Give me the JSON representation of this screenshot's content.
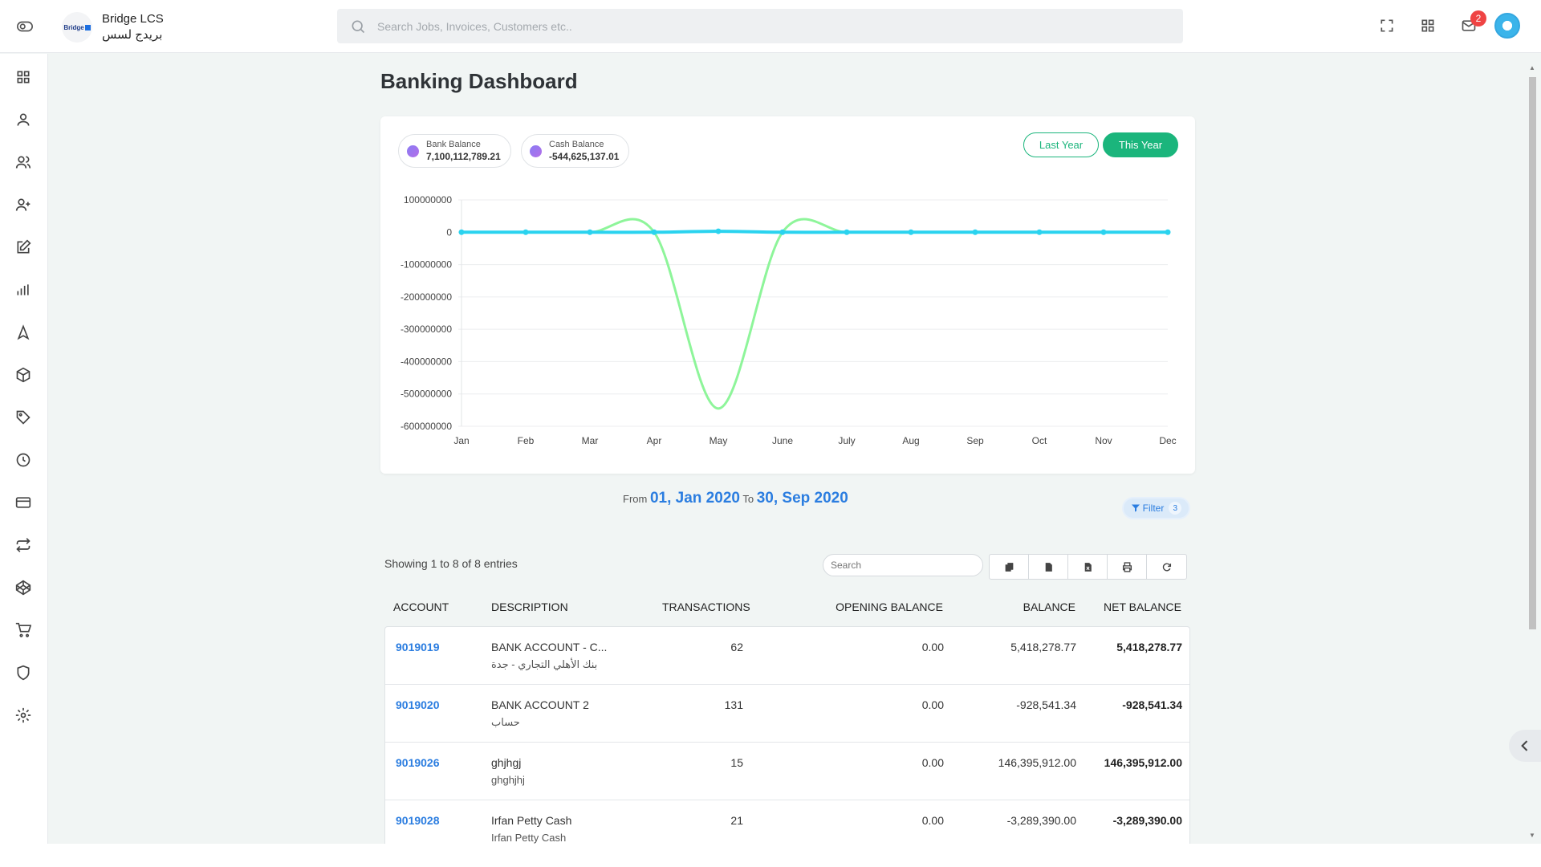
{
  "header": {
    "logo_text": "Bridge",
    "brand_en": "Bridge LCS",
    "brand_ar": "بريدج لسس",
    "search_placeholder": "Search Jobs, Invoices, Customers etc..",
    "notification_count": "2"
  },
  "sidebar": {
    "items": [
      {
        "icon": "dashboard-icon"
      },
      {
        "icon": "user-icon"
      },
      {
        "icon": "users-icon"
      },
      {
        "icon": "user-plus-icon"
      },
      {
        "icon": "edit-icon"
      },
      {
        "icon": "bar-chart-icon"
      },
      {
        "icon": "navigation-icon"
      },
      {
        "icon": "package-icon"
      },
      {
        "icon": "tag-icon"
      },
      {
        "icon": "clock-icon"
      },
      {
        "icon": "credit-card-icon"
      },
      {
        "icon": "repeat-icon"
      },
      {
        "icon": "codepen-icon"
      },
      {
        "icon": "cart-icon"
      },
      {
        "icon": "shield-icon"
      },
      {
        "icon": "settings-icon"
      }
    ]
  },
  "page": {
    "title": "Banking Dashboard"
  },
  "legend": [
    {
      "label": "Bank Balance",
      "value": "7,100,112,789.21"
    },
    {
      "label": "Cash Balance",
      "value": "-544,625,137.01"
    }
  ],
  "period": {
    "last_year": "Last Year",
    "this_year": "This Year"
  },
  "colors": {
    "accent": "#1bb57c",
    "link": "#2b7de0",
    "bank_line": "#2ad3ef",
    "cash_line": "#8ef59a"
  },
  "chart_data": {
    "type": "line",
    "categories": [
      "Jan",
      "Feb",
      "Mar",
      "Apr",
      "May",
      "June",
      "July",
      "Aug",
      "Sep",
      "Oct",
      "Nov",
      "Dec"
    ],
    "y_ticks": [
      "100000000",
      "0",
      "-100000000",
      "-200000000",
      "-300000000",
      "-400000000",
      "-500000000",
      "-600000000"
    ],
    "ylim": [
      -600000000,
      100000000
    ],
    "grid": true,
    "series": [
      {
        "name": "Bank Balance",
        "color": "#2ad3ef",
        "values": [
          0,
          0,
          0,
          0,
          3000000,
          0,
          0,
          0,
          0,
          0,
          0,
          0
        ]
      },
      {
        "name": "Cash Balance",
        "color": "#8ef59a",
        "values": [
          0,
          0,
          0,
          0,
          -545000000,
          0,
          0,
          0,
          0,
          0,
          0,
          0
        ]
      }
    ]
  },
  "date_range": {
    "from_label": "From",
    "from": "01, Jan 2020",
    "to_label": "To",
    "to": "30, Sep 2020"
  },
  "filter": {
    "label": "Filter",
    "count": "3"
  },
  "table": {
    "showing": "Showing 1 to 8 of 8 entries",
    "search_placeholder": "Search",
    "columns": [
      "ACCOUNT",
      "DESCRIPTION",
      "TRANSACTIONS",
      "OPENING BALANCE",
      "BALANCE",
      "NET BALANCE"
    ],
    "rows": [
      {
        "account": "9019019",
        "description": "BANK ACCOUNT - C...",
        "sub": "بنك الأهلي التجاري - جدة",
        "transactions": "62",
        "opening": "0.00",
        "balance": "5,418,278.77",
        "net": "5,418,278.77"
      },
      {
        "account": "9019020",
        "description": "BANK ACCOUNT 2",
        "sub": "حساب",
        "transactions": "131",
        "opening": "0.00",
        "balance": "-928,541.34",
        "net": "-928,541.34"
      },
      {
        "account": "9019026",
        "description": "ghjhgj",
        "sub": "ghghjhj",
        "transactions": "15",
        "opening": "0.00",
        "balance": "146,395,912.00",
        "net": "146,395,912.00"
      },
      {
        "account": "9019028",
        "description": "Irfan Petty Cash",
        "sub": "Irfan Petty Cash",
        "transactions": "21",
        "opening": "0.00",
        "balance": "-3,289,390.00",
        "net": "-3,289,390.00"
      }
    ]
  }
}
